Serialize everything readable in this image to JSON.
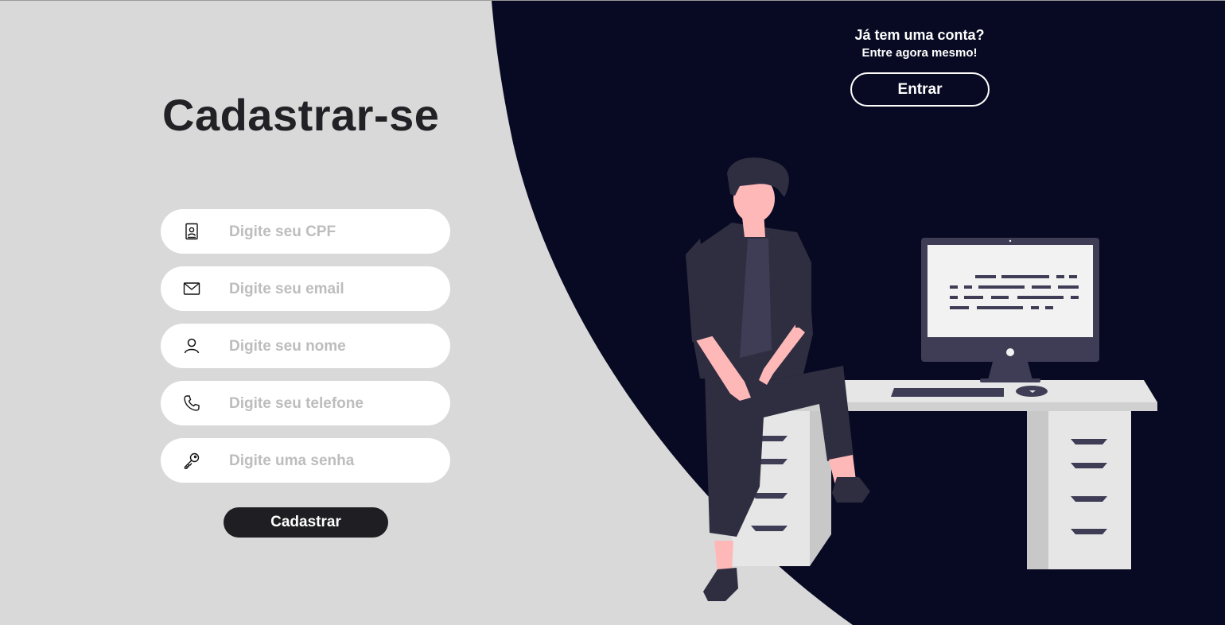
{
  "colors": {
    "left_bg": "#d9d9d9",
    "right_bg": "#070a22",
    "title_text": "#222226",
    "field_bg": "#ffffff",
    "placeholder": "#bdbdbd",
    "primary_button": "#1f1f23"
  },
  "signup": {
    "title": "Cadastrar-se",
    "fields": [
      {
        "icon": "id-card-icon",
        "placeholder": "Digite seu CPF",
        "value": ""
      },
      {
        "icon": "mail-icon",
        "placeholder": "Digite seu email",
        "value": ""
      },
      {
        "icon": "user-icon",
        "placeholder": "Digite seu nome",
        "value": ""
      },
      {
        "icon": "phone-icon",
        "placeholder": "Digite seu telefone",
        "value": ""
      },
      {
        "icon": "key-icon",
        "placeholder": "Digite uma senha",
        "value": ""
      }
    ],
    "submit_label": "Cadastrar"
  },
  "login_prompt": {
    "question": "Já tem uma conta?",
    "subtitle": "Entre agora mesmo!",
    "button_label": "Entrar"
  },
  "illustration": {
    "icon": "person-at-desk-illustration"
  }
}
